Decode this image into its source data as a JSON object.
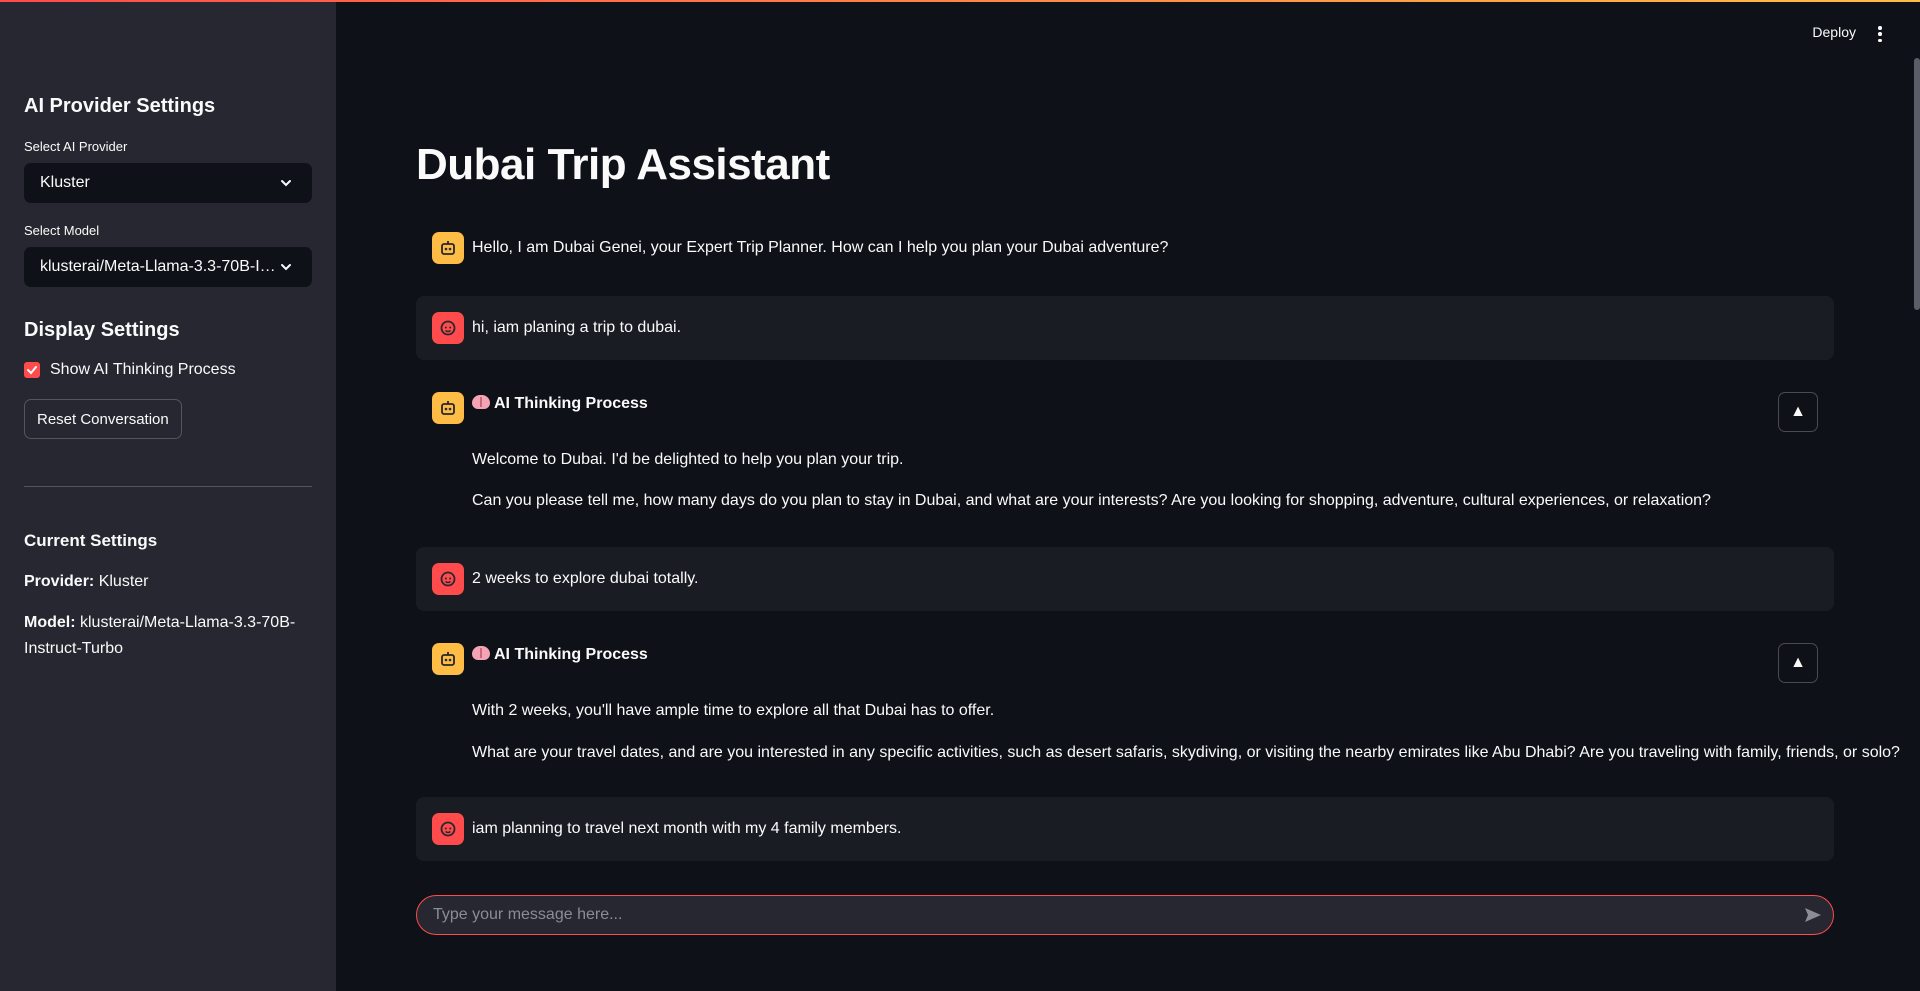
{
  "header": {
    "deploy_label": "Deploy"
  },
  "sidebar": {
    "provider_heading": "AI Provider Settings",
    "provider_label": "Select AI Provider",
    "provider_value": "Kluster",
    "model_label": "Select Model",
    "model_value": "klusterai/Meta-Llama-3.3-70B-Instruct-Turbo",
    "display_heading": "Display Settings",
    "show_thinking_label": "Show AI Thinking Process",
    "show_thinking_checked": true,
    "reset_button": "Reset Conversation",
    "current_heading": "Current Settings",
    "provider_key": "Provider:",
    "provider_current": "Kluster",
    "model_key": "Model:",
    "model_current": "klusterai/Meta-Llama-3.3-70B-Instruct-Turbo"
  },
  "main": {
    "title": "Dubai Trip Assistant",
    "messages": [
      {
        "role": "assistant",
        "text": "Hello, I am Dubai Genei, your Expert Trip Planner. How can I help you plan your Dubai adventure?"
      },
      {
        "role": "user",
        "text": "hi, iam planing a trip to dubai."
      },
      {
        "role": "assistant",
        "heading": "AI Thinking Process",
        "paragraphs": [
          "Welcome to Dubai. I'd be delighted to help you plan your trip.",
          "Can you please tell me, how many days do you plan to stay in Dubai, and what are your interests? Are you looking for shopping, adventure, cultural experiences, or relaxation?"
        ]
      },
      {
        "role": "user",
        "text": "2 weeks to explore dubai totally."
      },
      {
        "role": "assistant",
        "heading": "AI Thinking Process",
        "paragraphs": [
          "With 2 weeks, you'll have ample time to explore all that Dubai has to offer.",
          "What are your travel dates, and are you interested in any specific activities, such as desert safaris, skydiving, or visiting the nearby emirates like Abu Dhabi? Are you traveling with family, friends, or solo?"
        ]
      },
      {
        "role": "user",
        "text": "iam planning to travel next month with my 4 family members."
      }
    ],
    "input_placeholder": "Type your message here..."
  },
  "colors": {
    "accent": "#ff4b4b",
    "bot_avatar": "#ffbd45",
    "background": "#0e1117",
    "sidebar": "#262730"
  }
}
